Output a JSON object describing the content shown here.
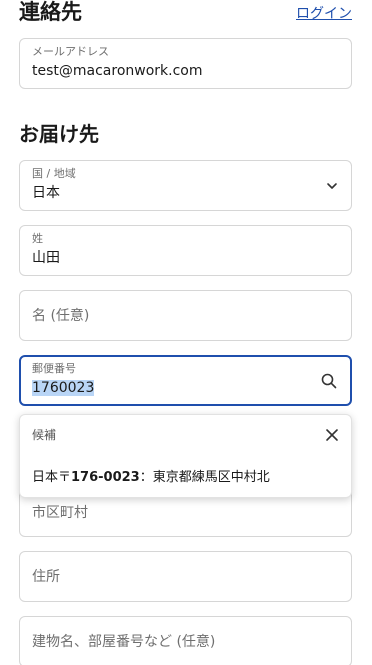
{
  "contact": {
    "title": "連絡先",
    "login_link": "ログイン",
    "email_label": "メールアドレス",
    "email_value": "test@macaronwork.com"
  },
  "shipping": {
    "title": "お届け先",
    "country_label": "国 / 地域",
    "country_value": "日本",
    "last_name_label": "姓",
    "last_name_value": "山田",
    "first_name_placeholder": "名 (任意)",
    "postal_label": "郵便番号",
    "postal_value": "1760023",
    "city_placeholder": "市区町村",
    "address_placeholder": "住所",
    "building_placeholder": "建物名、部屋番号など (任意)"
  },
  "suggestions": {
    "title": "候補",
    "item_prefix": "日本〒",
    "item_code": "176-0023",
    "item_suffix": "：東京都練馬区中村北"
  },
  "colors": {
    "accent": "#1f4fad",
    "selection": "#b9d5f6",
    "border": "#d6d6d6"
  },
  "icons": {
    "country_select": "chevron-down-icon",
    "postal_search": "search-icon",
    "popup_close": "close-icon"
  }
}
